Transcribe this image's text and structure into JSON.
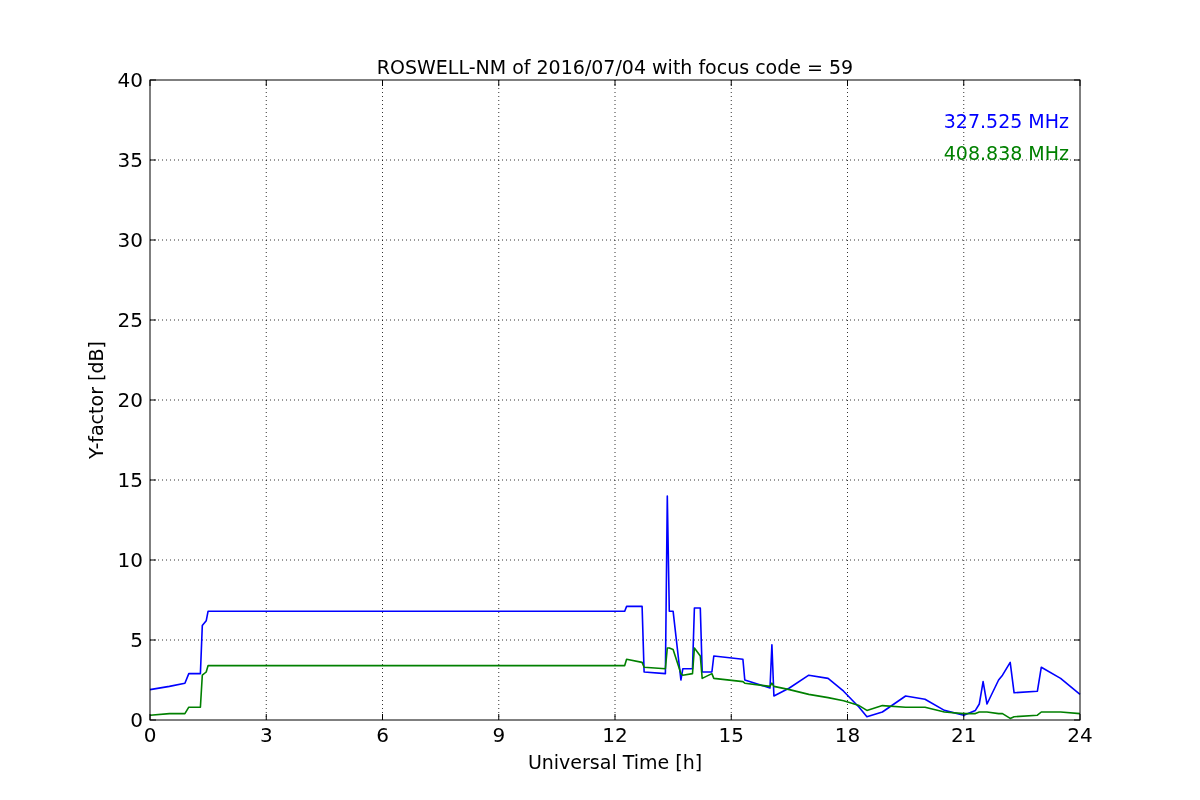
{
  "chart_data": {
    "type": "line",
    "title": "ROSWELL-NM of 2016/07/04 with focus code = 59",
    "xlabel": "Universal Time [h]",
    "ylabel": "Y-factor [dB]",
    "x": [
      0,
      0.5,
      0.9,
      1.0,
      1.3,
      1.35,
      1.45,
      1.5,
      12.25,
      12.3,
      12.7,
      12.75,
      13.3,
      13.35,
      13.4,
      13.5,
      13.7,
      13.75,
      14.0,
      14.05,
      14.2,
      14.25,
      14.5,
      14.55,
      15.3,
      15.35,
      16.0,
      16.05,
      16.1,
      16.5,
      17.0,
      17.5,
      17.9,
      18.3,
      18.5,
      18.9,
      19.5,
      20.0,
      20.5,
      21.0,
      21.3,
      21.4,
      21.5,
      21.6,
      21.9,
      22.0,
      22.2,
      22.3,
      22.9,
      23.0,
      23.5,
      24
    ],
    "series": [
      {
        "name": "327.525 MHz",
        "color": "#0000ff",
        "values": [
          1.9,
          2.1,
          2.3,
          2.9,
          2.9,
          5.9,
          6.2,
          6.8,
          6.8,
          7.1,
          7.1,
          3.0,
          2.9,
          14.0,
          6.8,
          6.8,
          2.5,
          3.2,
          3.2,
          7.0,
          7.0,
          3.0,
          3.0,
          4.0,
          3.8,
          2.5,
          2.0,
          4.7,
          1.5,
          2.0,
          2.8,
          2.6,
          1.8,
          0.8,
          0.2,
          0.5,
          1.5,
          1.3,
          0.6,
          0.3,
          0.6,
          1.0,
          2.4,
          1.0,
          2.5,
          2.8,
          3.6,
          1.7,
          1.8,
          3.3,
          2.6,
          1.6
        ]
      },
      {
        "name": "408.838 MHz",
        "color": "#008000",
        "values": [
          0.3,
          0.4,
          0.4,
          0.8,
          0.8,
          2.8,
          3.0,
          3.4,
          3.4,
          3.8,
          3.6,
          3.3,
          3.2,
          4.5,
          4.5,
          4.4,
          2.9,
          2.8,
          2.9,
          4.5,
          4.0,
          2.6,
          2.9,
          2.6,
          2.4,
          2.3,
          2.1,
          2.3,
          2.1,
          1.9,
          1.6,
          1.4,
          1.2,
          0.9,
          0.6,
          0.9,
          0.8,
          0.8,
          0.5,
          0.4,
          0.4,
          0.5,
          0.5,
          0.5,
          0.4,
          0.4,
          0.1,
          0.2,
          0.3,
          0.5,
          0.5,
          0.4
        ]
      }
    ],
    "grid": true,
    "xlim": [
      0,
      24
    ],
    "ylim": [
      0,
      40
    ],
    "xticks": [
      0,
      3,
      6,
      9,
      12,
      15,
      18,
      21,
      24
    ],
    "yticks": [
      0,
      5,
      10,
      15,
      20,
      25,
      30,
      35,
      40
    ]
  }
}
